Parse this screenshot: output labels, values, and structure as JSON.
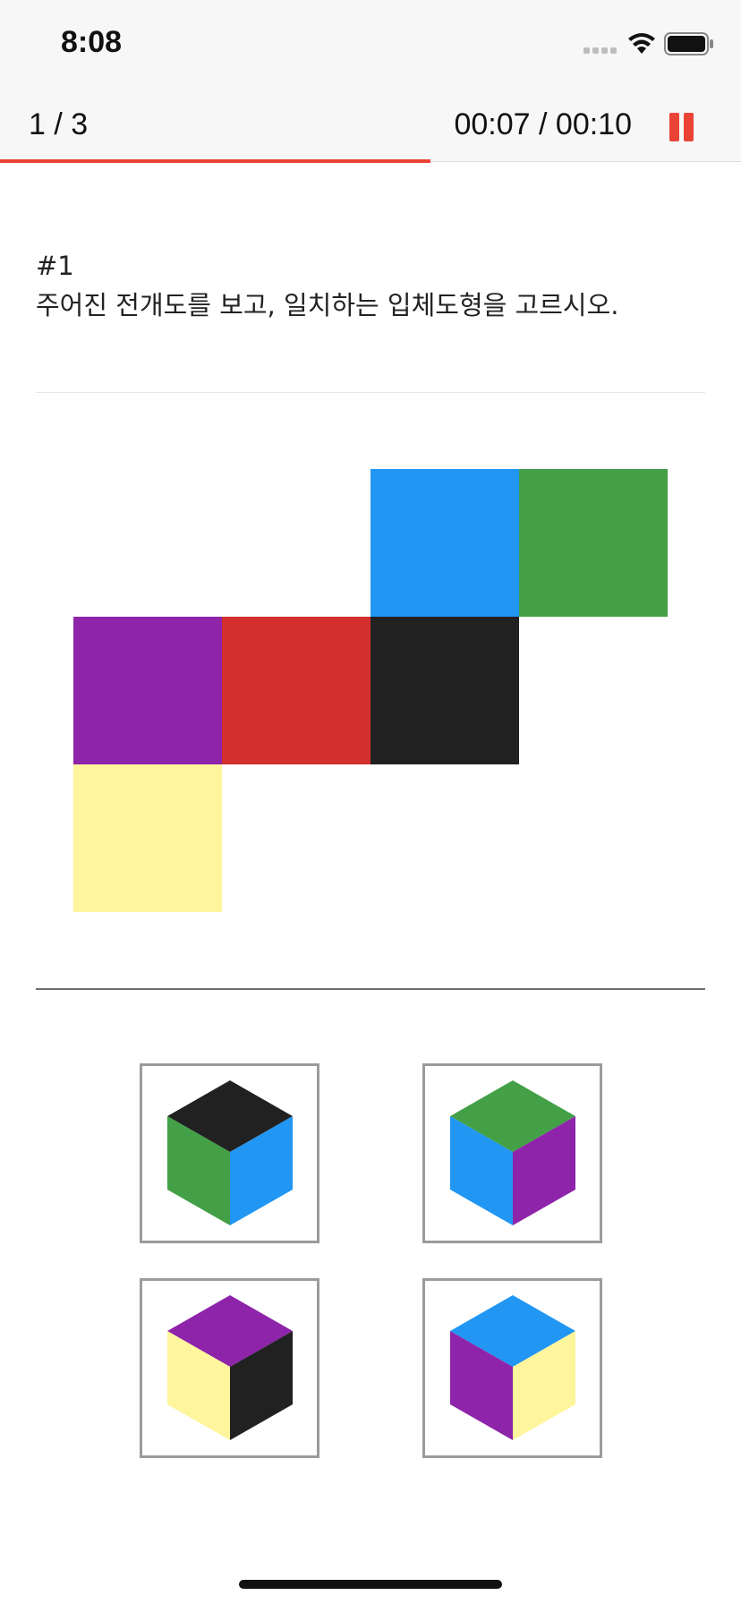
{
  "status_bar": {
    "time": "8:08",
    "icons": [
      "signal-icon",
      "wifi-icon",
      "battery-icon"
    ]
  },
  "header": {
    "counter": "1 / 3",
    "timer": "00:07 / 00:10",
    "pause_icon": "pause-icon",
    "accent_color": "#ea4335",
    "progress_fraction": 0.7
  },
  "question": {
    "number": "#1",
    "text": "주어진 전개도를 보고, 일치하는 입체도형을 고르시오."
  },
  "colors": {
    "blue": "#2196f3",
    "green": "#43a047",
    "purple": "#8e24aa",
    "red": "#d32f2f",
    "black": "#212121",
    "yellow": "#fff59d"
  },
  "net": {
    "faces": [
      "blue",
      "green",
      "purple",
      "red",
      "black",
      "yellow"
    ]
  },
  "options": [
    {
      "label": "option-1",
      "top": "black",
      "left": "green",
      "right": "blue"
    },
    {
      "label": "option-2",
      "top": "green",
      "left": "blue",
      "right": "purple"
    },
    {
      "label": "option-3",
      "top": "purple",
      "left": "yellow",
      "right": "black"
    },
    {
      "label": "option-4",
      "top": "blue",
      "left": "purple",
      "right": "yellow"
    }
  ]
}
